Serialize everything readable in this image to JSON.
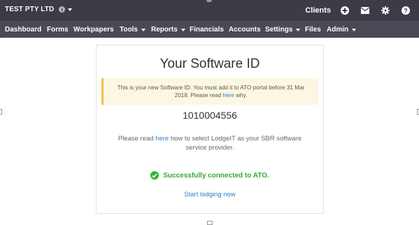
{
  "header": {
    "company": "TEST PTY LTD",
    "clients_label": "Clients",
    "icons": [
      "plus-circle-icon",
      "envelope-icon",
      "gear-icon",
      "help-icon"
    ]
  },
  "nav": {
    "items": [
      {
        "label": "Dashboard"
      },
      {
        "label": "Forms"
      },
      {
        "label": "Workpapers"
      },
      {
        "label": "Tools",
        "dropdown": true
      },
      {
        "label": "Reports",
        "dropdown": true
      },
      {
        "label": "Financials"
      },
      {
        "label": "Accounts"
      },
      {
        "label": "Settings",
        "dropdown": true
      },
      {
        "label": "Files"
      },
      {
        "label": "Admin",
        "dropdown": true
      }
    ]
  },
  "card": {
    "title": "Your Software ID",
    "alert": {
      "line1": "This is your new Software ID. You must add it to ATO portal before 31 Mar",
      "line2_pre": "2018. Please read ",
      "line2_link": "here",
      "line2_post": " why."
    },
    "software_id": "1010004556",
    "read": {
      "pre": "Please read ",
      "link": "here",
      "post": " how to select LodgeIT as your SBR software service provider."
    },
    "success_text": "Successfully connected to ATO.",
    "start_link": "Start lodging now"
  },
  "colors": {
    "topbar": "#3c3c47",
    "navbar": "#4a4a56",
    "link": "#2c7ec8",
    "success": "#33aa33",
    "alert_bg": "#fcf7e3",
    "alert_border": "#f0c050"
  }
}
